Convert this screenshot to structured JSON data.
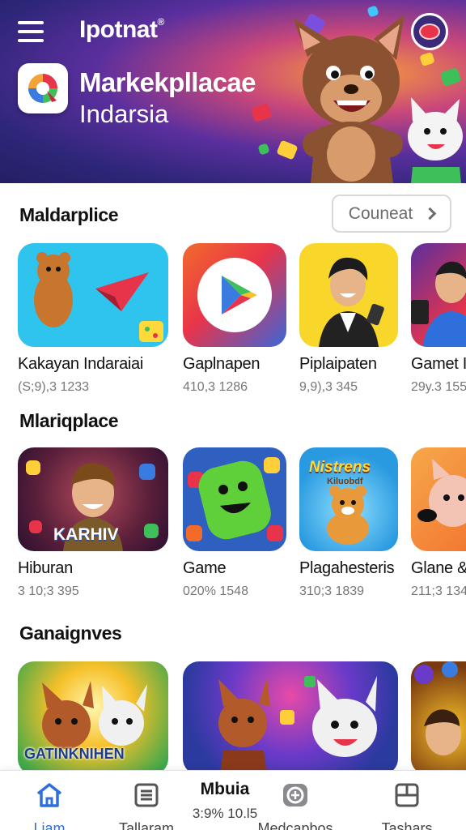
{
  "header": {
    "app_name": "Ipotnat",
    "reg_mark": "®",
    "title": "Markekpllacae",
    "subtitle": "Indarsia",
    "icons": [
      "hamburger-menu-icon",
      "app-logo-icon",
      "brand-badge-icon"
    ]
  },
  "sections": [
    {
      "title": "Maldarplice",
      "more_label": "Couneat",
      "items": [
        {
          "title": "Kakayan Indaraiai",
          "meta": "(S;9),3 1233"
        },
        {
          "title": "Gaplnapen",
          "meta": "410,3 1286"
        },
        {
          "title": "Piplaipaten",
          "meta": "9,9),3 345"
        },
        {
          "title": "Gamet I",
          "meta": "29y.3 155"
        }
      ]
    },
    {
      "title": "Mlariqplace",
      "items": [
        {
          "title": "Hiburan",
          "meta": "3 10;3 395",
          "badge": "KARHIV"
        },
        {
          "title": "Game",
          "meta": "020% 1548"
        },
        {
          "title": "Plagahesteris",
          "meta": "310;3 1839",
          "badge": "Nistrens",
          "badge_sub": "Kiluobdf"
        },
        {
          "title": "Glane &",
          "meta": "211;3 134"
        }
      ]
    },
    {
      "title": "Ganaignves",
      "items": [
        {
          "badge": "GATINKNIHEN"
        },
        {},
        {}
      ]
    }
  ],
  "bottom_nav": {
    "items": [
      {
        "label": "Liam",
        "icon": "home-icon",
        "active": true
      },
      {
        "label": "Tallaram",
        "icon": "list-icon"
      },
      {
        "label": "Medcapbos",
        "icon": "gamepad-icon"
      },
      {
        "label": "Tashars",
        "icon": "grid-icon"
      }
    ],
    "popup_title": "Mbuia",
    "popup_sub": "3:9% 10.l5"
  },
  "colors": {
    "accent": "#2f6fdb",
    "banner_dark": "#2e2679",
    "banner_warm": "#f59a3c"
  }
}
